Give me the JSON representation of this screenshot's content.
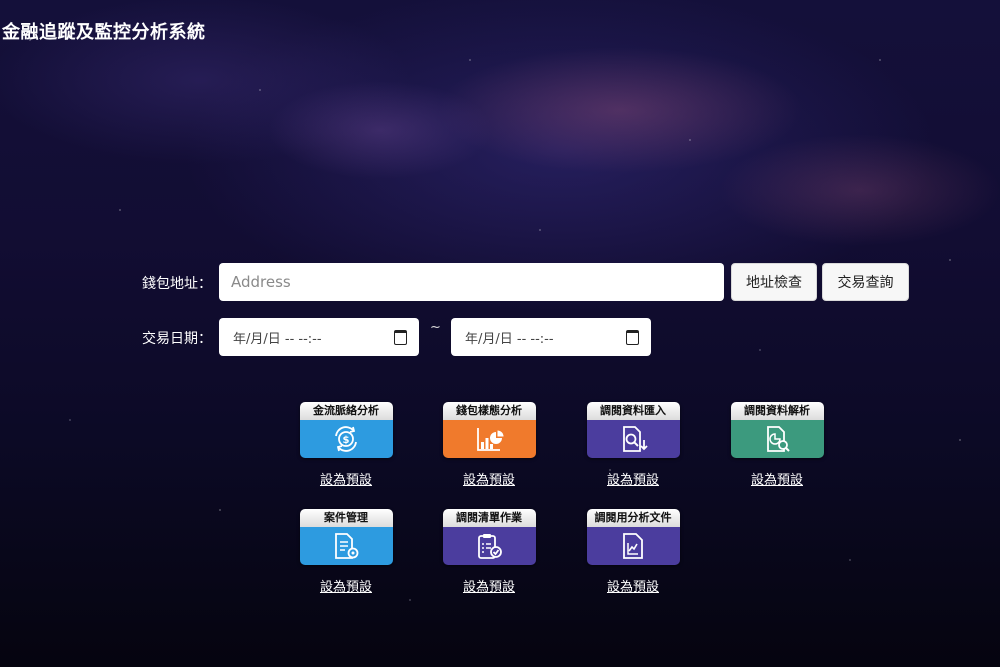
{
  "header": {
    "title": "金融追蹤及監控分析系統"
  },
  "search": {
    "wallet_label": "錢包地址：",
    "address_placeholder": "Address",
    "check_button": "地址檢查",
    "tx_query_button": "交易查詢"
  },
  "date_filter": {
    "label": "交易日期：",
    "start_value": "年/月/日 -- --:--",
    "separator": "~",
    "end_value": "年/月/日 -- --:--"
  },
  "modules": [
    {
      "title": "金流脈絡分析",
      "color": "#2d9be0",
      "icon": "money-cycle-icon",
      "link": "設為預設"
    },
    {
      "title": "錢包樣態分析",
      "color": "#f07a2c",
      "icon": "bar-pie-chart-icon",
      "link": "設為預設"
    },
    {
      "title": "調閱資料匯入",
      "color": "#4b3d9e",
      "icon": "document-search-import-icon",
      "link": "設為預設"
    },
    {
      "title": "調閱資料解析",
      "color": "#3c9a7e",
      "icon": "document-analysis-icon",
      "link": "設為預設"
    },
    {
      "title": "案件管理",
      "color": "#2d9be0",
      "icon": "case-document-gear-icon",
      "link": "設為預設"
    },
    {
      "title": "調閱清單作業",
      "color": "#4b3d9e",
      "icon": "clipboard-check-icon",
      "link": "設為預設"
    },
    {
      "title": "調閱用分析文件",
      "color": "#4b3d9e",
      "icon": "document-chart-icon",
      "link": "設為預設"
    }
  ]
}
